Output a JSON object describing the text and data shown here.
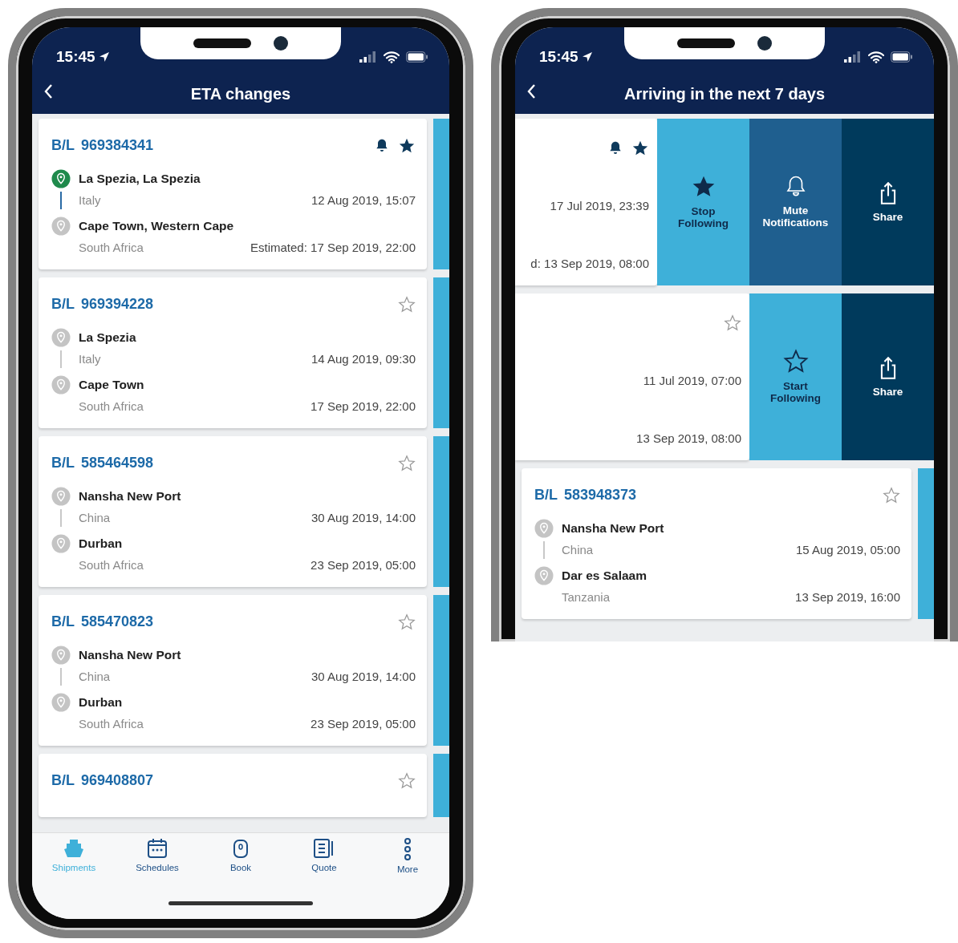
{
  "phones": [
    {
      "status_bar": {
        "time": "15:45"
      },
      "header": {
        "title": "ETA changes"
      },
      "shipments": [
        {
          "bl_label": "B/L",
          "bl_number": "969384341",
          "notifications": true,
          "following": true,
          "origin": {
            "name": "La Spezia, La Spezia",
            "country": "Italy",
            "date": "12 Aug 2019, 15:07",
            "reached": true
          },
          "destination": {
            "name": "Cape Town, Western Cape",
            "country": "South Africa",
            "date": "Estimated: 17 Sep 2019, 22:00",
            "reached": false
          }
        },
        {
          "bl_label": "B/L",
          "bl_number": "969394228",
          "notifications": false,
          "following": false,
          "origin": {
            "name": "La Spezia",
            "country": "Italy",
            "date": "14 Aug 2019, 09:30",
            "reached": false
          },
          "destination": {
            "name": "Cape Town",
            "country": "South Africa",
            "date": "17 Sep 2019, 22:00",
            "reached": false
          }
        },
        {
          "bl_label": "B/L",
          "bl_number": "585464598",
          "notifications": false,
          "following": false,
          "origin": {
            "name": "Nansha New Port",
            "country": "China",
            "date": "30 Aug 2019, 14:00",
            "reached": false
          },
          "destination": {
            "name": "Durban",
            "country": "South Africa",
            "date": "23 Sep 2019, 05:00",
            "reached": false
          }
        },
        {
          "bl_label": "B/L",
          "bl_number": "585470823",
          "notifications": false,
          "following": false,
          "origin": {
            "name": "Nansha New Port",
            "country": "China",
            "date": "30 Aug 2019, 14:00",
            "reached": false
          },
          "destination": {
            "name": "Durban",
            "country": "South Africa",
            "date": "23 Sep 2019, 05:00",
            "reached": false
          }
        },
        {
          "bl_label": "B/L",
          "bl_number": "969408807",
          "notifications": false,
          "following": false
        }
      ],
      "tab_bar": [
        {
          "label": "Shipments",
          "selected": true
        },
        {
          "label": "Schedules",
          "selected": false
        },
        {
          "label": "Book",
          "selected": false
        },
        {
          "label": "Quote",
          "selected": false
        },
        {
          "label": "More",
          "selected": false
        }
      ]
    },
    {
      "status_bar": {
        "time": "15:45"
      },
      "header": {
        "title": "Arriving in the next 7 days"
      },
      "shipments": [
        {
          "notifications": true,
          "following": true,
          "origin": {
            "date": "17 Jul 2019, 23:39"
          },
          "destination": {
            "date": "d: 13 Sep 2019, 08:00"
          },
          "actions": [
            {
              "kind": "follow",
              "label": "Stop Following"
            },
            {
              "kind": "mute",
              "label": "Mute Notifications"
            },
            {
              "kind": "share",
              "label": "Share"
            }
          ]
        },
        {
          "notifications": false,
          "following": false,
          "origin": {
            "date": "11 Jul 2019, 07:00"
          },
          "destination": {
            "date": "13 Sep 2019, 08:00"
          },
          "actions": [
            {
              "kind": "follow",
              "label": "Start Following"
            },
            {
              "kind": "share",
              "label": "Share"
            }
          ]
        },
        {
          "bl_label": "B/L",
          "bl_number": "583948373",
          "notifications": false,
          "following": false,
          "origin": {
            "name": "Nansha New Port",
            "country": "China",
            "date": "15 Aug 2019, 05:00",
            "reached": false
          },
          "destination": {
            "name": "Dar es Salaam",
            "country": "Tanzania",
            "date": "13 Sep 2019, 16:00",
            "reached": false
          }
        }
      ]
    }
  ]
}
